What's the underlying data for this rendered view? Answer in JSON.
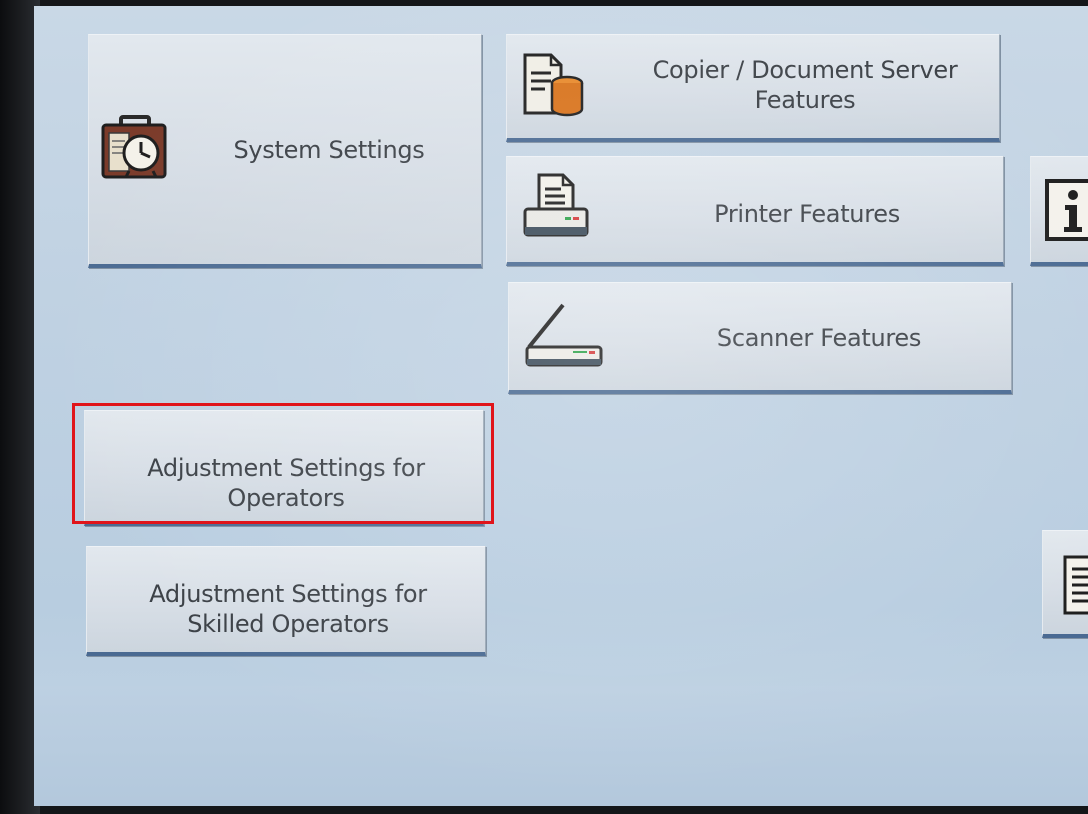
{
  "menu": {
    "system_settings": {
      "label": "System Settings",
      "icon": "clock-briefcase-icon"
    },
    "copier_document_server": {
      "label": "Copier / Document Server Features",
      "icon": "copier-docserver-icon"
    },
    "printer": {
      "label": "Printer Features",
      "icon": "printer-icon"
    },
    "scanner": {
      "label": "Scanner Features",
      "icon": "scanner-icon"
    },
    "adjustment_operators": {
      "label": "Adjustment Settings for Operators"
    },
    "adjustment_skilled": {
      "label": "Adjustment Settings for Skilled Operators"
    },
    "info": {
      "icon": "info-icon"
    },
    "list": {
      "icon": "list-icon"
    }
  },
  "highlight": {
    "target": "adjustment_operators",
    "color": "#e0141a"
  },
  "colors": {
    "screen": "#c4d6e6",
    "button_face": "#d9e0e7",
    "button_bottom_edge": "#4a6a92",
    "text": "#3b4046"
  }
}
